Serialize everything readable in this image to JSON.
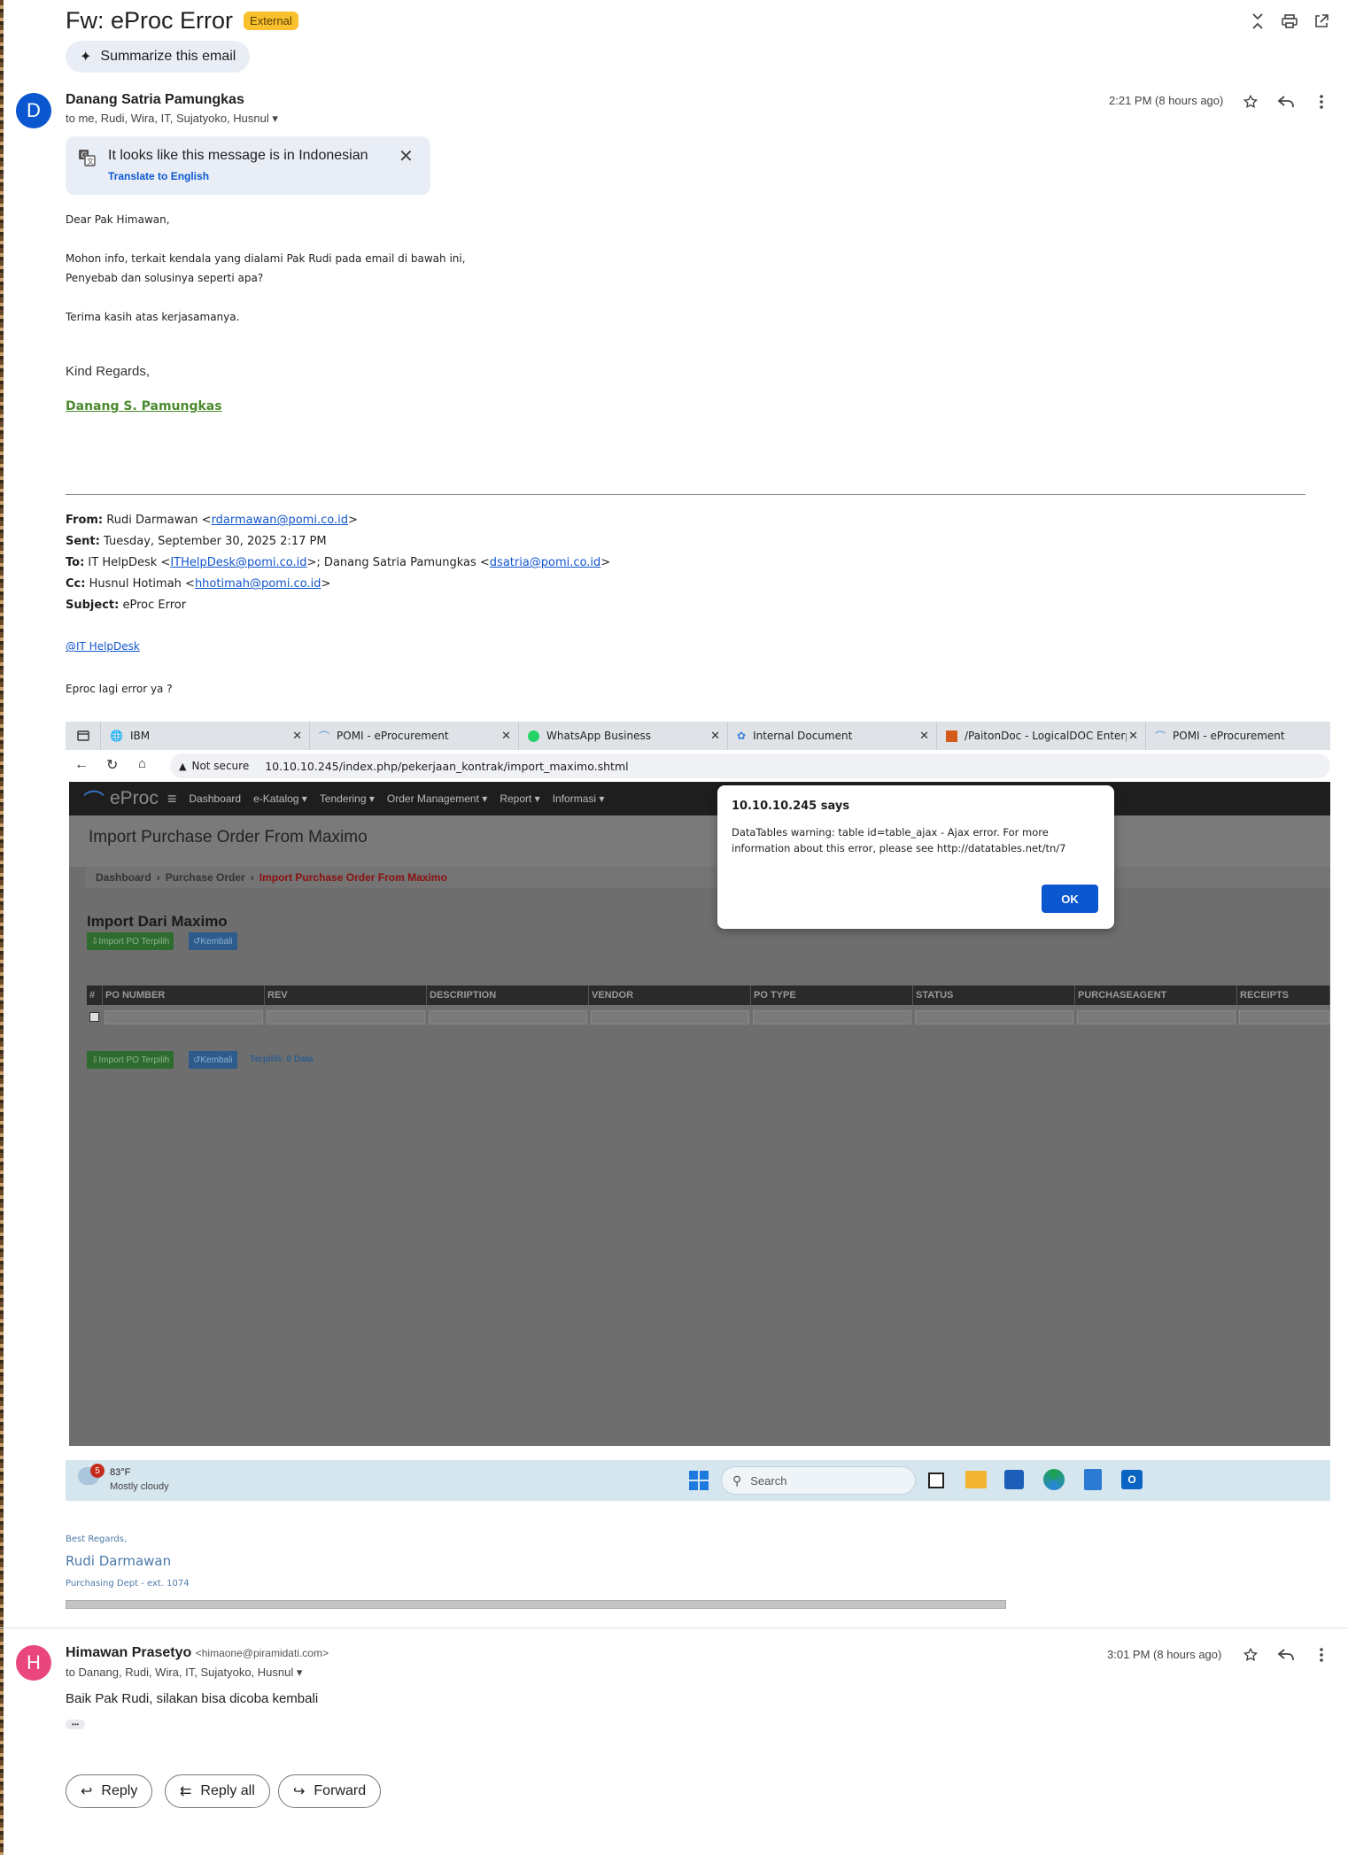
{
  "email": {
    "subject": "Fw: eProc Error",
    "external_badge": "External",
    "summarize_label": "Summarize this email"
  },
  "message1": {
    "avatar_letter": "D",
    "avatar_color": "#0b57d0",
    "sender": "Danang Satria Pamungkas",
    "recipients": "to me, Rudi, Wira, IT, Sujatyoko, Husnul",
    "time": "2:21 PM (8 hours ago)",
    "translate_text": "It looks like this message is in Indonesian",
    "translate_link": "Translate to English",
    "body": {
      "greeting": "Dear Pak Himawan,",
      "line1": "Mohon info, terkait kendala yang dialami Pak Rudi pada email di bawah ini,",
      "line2": "Penyebab dan solusinya seperti apa?",
      "line3": "Terima kasih atas kerjasamanya.",
      "regards": "Kind Regards,",
      "sig_name": "Danang S. Pamungkas"
    },
    "forwarded": {
      "from_label": "From:",
      "from_name": "Rudi Darmawan <",
      "from_email": "rdarmawan@pomi.co.id",
      "from_close": ">",
      "sent_label": "Sent:",
      "sent_value": "Tuesday, September 30, 2025 2:17 PM",
      "to_label": "To:",
      "to_1": "IT HelpDesk <",
      "to_1_email": "ITHelpDesk@pomi.co.id",
      "to_2": ">; Danang Satria Pamungkas <",
      "to_2_email": "dsatria@pomi.co.id",
      "to_close": ">",
      "cc_label": "Cc:",
      "cc_name": "Husnul Hotimah <",
      "cc_email": "hhotimah@pomi.co.id",
      "cc_close": ">",
      "subject_label": "Subject:",
      "subject_value": "eProc Error",
      "mention": "@IT HelpDesk",
      "question": "Eproc lagi error ya ?"
    },
    "signature": {
      "best": "Best Regards,",
      "name": "Rudi Darmawan",
      "dept": "Purchasing Dept - ext. 1074"
    }
  },
  "screenshot": {
    "tabs": [
      "IBM",
      "POMI - eProcurement",
      "WhatsApp Business",
      "Internal Document",
      "/PaitonDoc - LogicalDOC Enterpr",
      "POMI - eProcurement"
    ],
    "not_secure": "Not secure",
    "url": "10.10.10.245/index.php/pekerjaan_kontrak/import_maximo.shtml",
    "logo": "eProc",
    "nav": [
      "Dashboard",
      "e-Katalog ▾",
      "Tendering ▾",
      "Order Management ▾",
      "Report ▾",
      "Informasi ▾"
    ],
    "page_title": "Import Purchase Order From Maximo",
    "breadcrumb": [
      "Dashboard",
      "Purchase Order",
      "Import Purchase Order From Maximo"
    ],
    "section_title": "Import Dari Maximo",
    "btn_import": "Import PO Terpilih",
    "btn_back": "Kembali",
    "columns": [
      "#",
      "PO NUMBER",
      "REV",
      "DESCRIPTION",
      "VENDOR",
      "PO TYPE",
      "STATUS",
      "PURCHASEAGENT",
      "RECEIPTS"
    ],
    "selected_text": "Terpilih: 0 Data",
    "dialog_title": "10.10.10.245 says",
    "dialog_msg1": "DataTables warning: table id=table_ajax - Ajax error. For more",
    "dialog_msg2": "information about this error, please see http://datatables.net/tn/7",
    "dialog_ok": "OK",
    "weather_temp": "83°F",
    "weather_desc": "Mostly cloudy",
    "weather_badge": "5",
    "search_placeholder": "Search"
  },
  "message2": {
    "avatar_letter": "H",
    "avatar_color": "#e8467c",
    "sender": "Himawan Prasetyo",
    "sender_email": "<himaone@piramidati.com>",
    "recipients": "to Danang, Rudi, Wira, IT, Sujatyoko, Husnul",
    "time": "3:01 PM (8 hours ago)",
    "body": "Baik Pak Rudi, silakan bisa dicoba kembali",
    "ellipsis": "•••"
  },
  "actions": {
    "reply": "Reply",
    "reply_all": "Reply all",
    "forward": "Forward"
  }
}
